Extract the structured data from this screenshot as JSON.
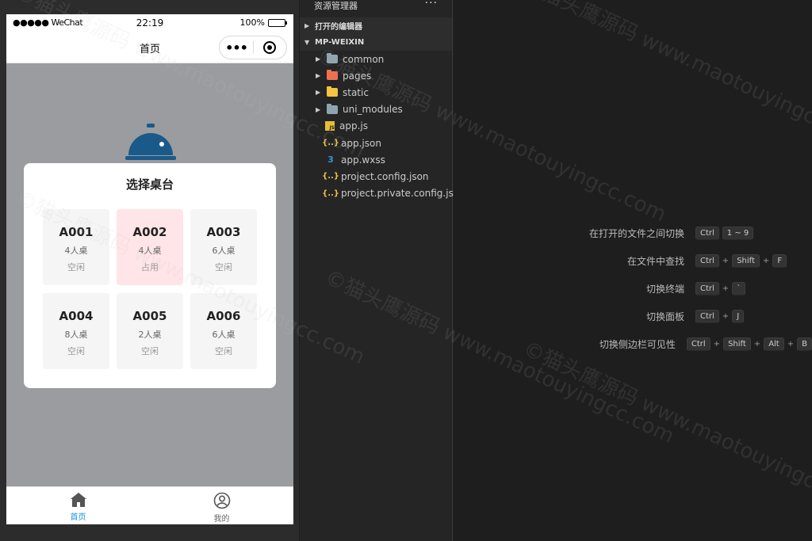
{
  "simulator": {
    "status_bar": {
      "carrier": "●●●●● WeChat",
      "time": "22:19",
      "battery": "100%"
    },
    "nav": {
      "title": "首页",
      "more": "•••"
    },
    "modal": {
      "title": "选择桌台",
      "tables": [
        {
          "id": "A001",
          "seats": "4人桌",
          "status": "空闲",
          "busy": false
        },
        {
          "id": "A002",
          "seats": "4人桌",
          "status": "占用",
          "busy": true
        },
        {
          "id": "A003",
          "seats": "6人桌",
          "status": "空闲",
          "busy": false
        },
        {
          "id": "A004",
          "seats": "8人桌",
          "status": "空闲",
          "busy": false
        },
        {
          "id": "A005",
          "seats": "2人桌",
          "status": "空闲",
          "busy": false
        },
        {
          "id": "A006",
          "seats": "6人桌",
          "status": "空闲",
          "busy": false
        }
      ]
    },
    "tabbar": {
      "home": "首页",
      "mine": "我的"
    },
    "colors": {
      "accent": "#1296db",
      "busy_card": "#ffe5e7",
      "cloche": "#1a5a8a"
    }
  },
  "explorer": {
    "title": "资源管理器",
    "more": "···",
    "sections": {
      "open_editors": "打开的编辑器",
      "project": "MP-WEIXIN"
    },
    "folders": [
      {
        "name": "common",
        "icon": "folder-icon",
        "color": "#90a4ae"
      },
      {
        "name": "pages",
        "icon": "pages-folder-icon",
        "color": "#ef6f52"
      },
      {
        "name": "static",
        "icon": "static-folder-icon",
        "color": "#f4c542"
      },
      {
        "name": "uni_modules",
        "icon": "folder-icon",
        "color": "#90a4ae"
      }
    ],
    "files": [
      {
        "name": "app.js",
        "icon": "js-icon",
        "glyph": "JS"
      },
      {
        "name": "app.json",
        "icon": "json-icon",
        "glyph": "{..}"
      },
      {
        "name": "app.wxss",
        "icon": "css-icon",
        "glyph": "3"
      },
      {
        "name": "project.config.json",
        "icon": "json-icon",
        "glyph": "{..}"
      },
      {
        "name": "project.private.config.js...",
        "icon": "json-icon",
        "glyph": "{..}"
      }
    ]
  },
  "editor": {
    "shortcuts": [
      {
        "label": "在打开的文件之间切换",
        "keys": [
          "Ctrl",
          "1 ~ 9"
        ],
        "joiner": ""
      },
      {
        "label": "在文件中查找",
        "keys": [
          "Ctrl",
          "Shift",
          "F"
        ],
        "joiner": "+"
      },
      {
        "label": "切换终端",
        "keys": [
          "Ctrl",
          "`"
        ],
        "joiner": "+"
      },
      {
        "label": "切换面板",
        "keys": [
          "Ctrl",
          "J"
        ],
        "joiner": "+"
      },
      {
        "label": "切换侧边栏可见性",
        "keys": [
          "Ctrl",
          "Shift",
          "Alt",
          "B"
        ],
        "joiner": "+"
      }
    ]
  },
  "watermark": "©猫头鹰源码 www.maotouyingcc.com"
}
